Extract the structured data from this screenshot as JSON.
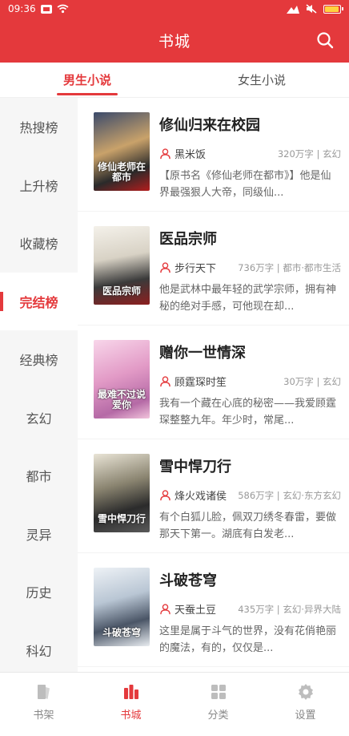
{
  "status_bar": {
    "time": "09:36"
  },
  "app_bar": {
    "title": "书城"
  },
  "tabs": [
    {
      "label": "男生小说",
      "active": true
    },
    {
      "label": "女生小说",
      "active": false
    }
  ],
  "sidebar": {
    "items": [
      {
        "label": "热搜榜"
      },
      {
        "label": "上升榜"
      },
      {
        "label": "收藏榜"
      },
      {
        "label": "完结榜",
        "active": true
      },
      {
        "label": "经典榜"
      },
      {
        "label": "玄幻"
      },
      {
        "label": "都市"
      },
      {
        "label": "灵异"
      },
      {
        "label": "历史"
      },
      {
        "label": "科幻"
      }
    ]
  },
  "books": [
    {
      "title": "修仙归来在校园",
      "author": "黑米饭",
      "meta": "320万字 | 玄幻",
      "desc": "【原书名《修仙老师在都市》】他是仙界最强狠人大帝，同级仙...",
      "cover_text": "修仙老师在都市"
    },
    {
      "title": "医品宗师",
      "author": "步行天下",
      "meta": "736万字 | 都市·都市生活",
      "desc": "他是武林中最年轻的武学宗师，拥有神秘的绝对手感，可他现在却...",
      "cover_text": "医品宗师"
    },
    {
      "title": "赠你一世情深",
      "author": "顾霆琛时笙",
      "meta": "30万字 | 玄幻",
      "desc": "我有一个藏在心底的秘密——我爱顾霆琛整整九年。年少时，常尾...",
      "cover_text": "最难不过说爱你"
    },
    {
      "title": "雪中悍刀行",
      "author": "烽火戏诸侯",
      "meta": "586万字 | 玄幻·东方玄幻",
      "desc": "有个白狐儿脸，佩双刀绣冬春雷，要做那天下第一。湖底有白发老...",
      "cover_text": "雪中悍刀行"
    },
    {
      "title": "斗破苍穹",
      "author": "天蚕土豆",
      "meta": "435万字 | 玄幻·异界大陆",
      "desc": "这里是属于斗气的世界，没有花俏艳丽的魔法，有的，仅仅是...",
      "cover_text": "斗破苍穹"
    }
  ],
  "bottom_nav": [
    {
      "label": "书架",
      "icon": "bookshelf-icon"
    },
    {
      "label": "书城",
      "icon": "bookstore-icon",
      "active": true
    },
    {
      "label": "分类",
      "icon": "category-icon"
    },
    {
      "label": "设置",
      "icon": "settings-icon"
    }
  ],
  "colors": {
    "accent": "#e4393c"
  }
}
